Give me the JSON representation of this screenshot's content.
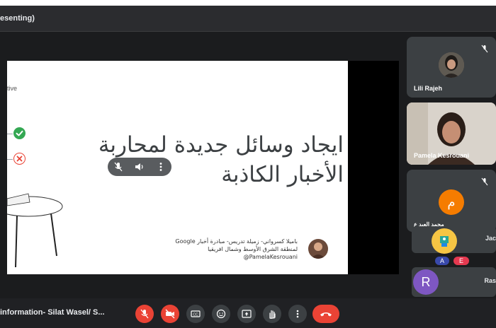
{
  "window": {
    "title": "esenting)"
  },
  "presentation": {
    "tag": "tive",
    "title_line1": "ايجاد وسائل جديدة لمحاربة",
    "title_line2": "الأخبار الكاذبة",
    "credit_line1": "باميلا كسرواني- زميلة تدريس- مبادرة أخبار Google",
    "credit_line2": "لمنطقة الشرق الأوسط وشمال افريقيا",
    "credit_line3": "PamelaKesrouani@"
  },
  "participants": [
    {
      "name": "Lili Rajeh",
      "muted": true
    },
    {
      "name": "Pamela Kesrouani",
      "muted": false
    },
    {
      "name": "محمد العبد ع",
      "initial": "م",
      "color": "#f57c00",
      "muted": true
    }
  ],
  "small_tiles": [
    {
      "name": "Jac"
    },
    {
      "name": "Ras",
      "initial": "R",
      "color": "#7e57c2"
    }
  ],
  "badges": [
    {
      "letter": "A",
      "color": "#3949ab"
    },
    {
      "letter": "E",
      "color": "#e53950"
    }
  ],
  "bottom_bar": {
    "meeting_name": "information- Silat Wasel/ S...",
    "controls": [
      "mic-off",
      "camera-off",
      "captions",
      "emoji",
      "present",
      "raise-hand",
      "more",
      "end-call"
    ],
    "colors": {
      "danger": "#ea4335",
      "surface": "#3c4043"
    }
  }
}
